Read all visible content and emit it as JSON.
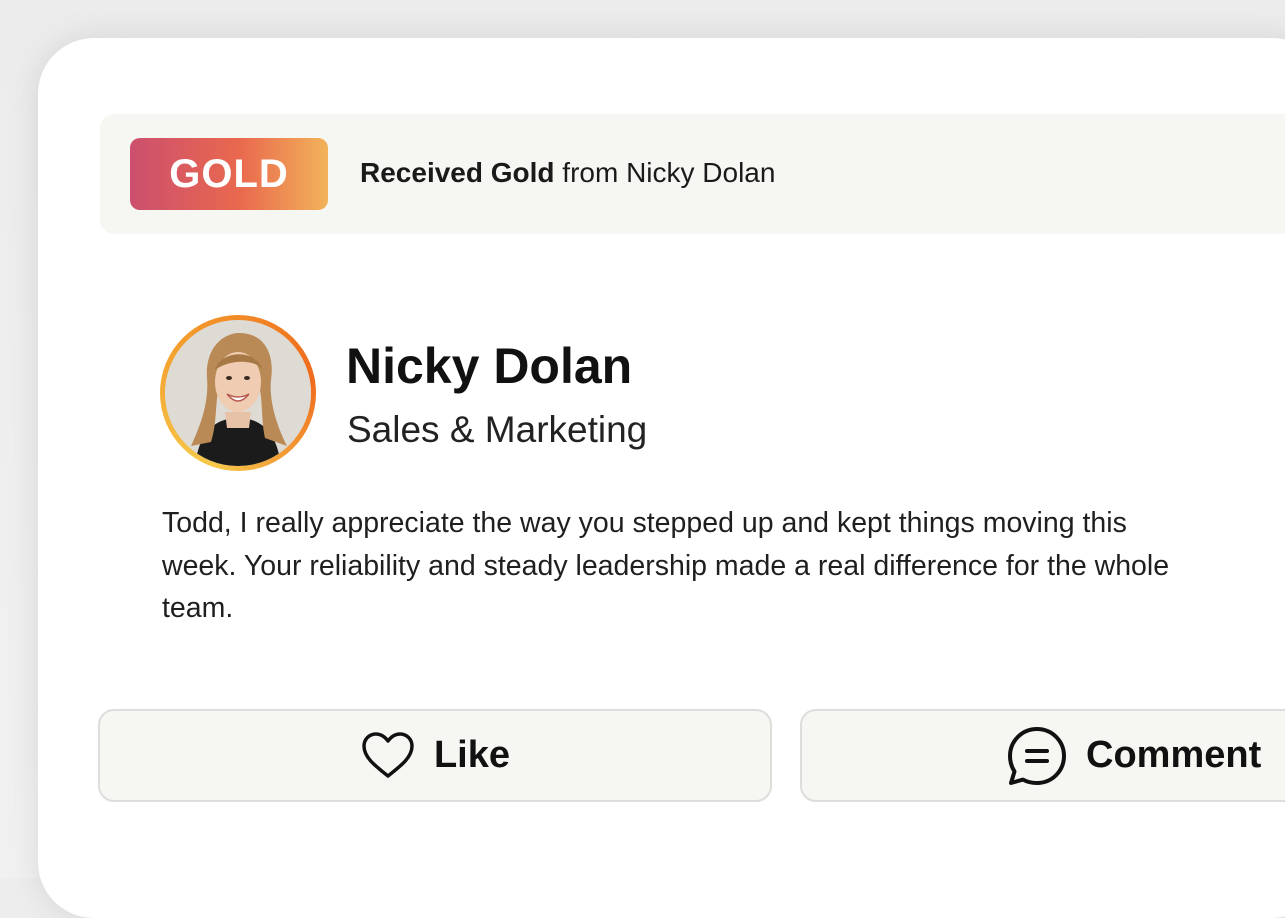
{
  "award": {
    "badge_label": "GOLD",
    "message_strong": "Received Gold",
    "message_rest": " from Nicky Dolan",
    "badge_gradient": [
      "#cc4f6e",
      "#e9684e",
      "#f2b35a"
    ]
  },
  "sender": {
    "name": "Nicky Dolan",
    "department": "Sales & Marketing",
    "avatar_ring_colors": [
      "#f7c94a",
      "#ef6a1d"
    ]
  },
  "post": {
    "message": "Todd, I really appreciate the way you stepped up and kept things moving this week. Your reliability and steady leadership made a real difference for the whole team."
  },
  "actions": {
    "like_label": "Like",
    "like_icon": "heart-icon",
    "comment_label": "Comment",
    "comment_icon": "comment-bubble-icon"
  }
}
